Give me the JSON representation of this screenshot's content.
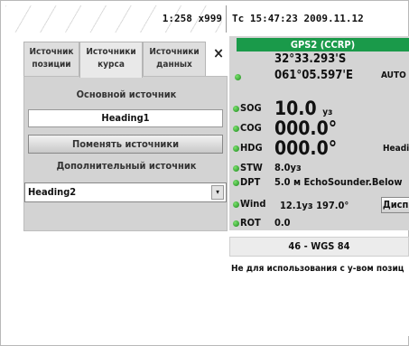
{
  "topbar": {
    "scale": "1:258 x999"
  },
  "clock": {
    "text": "Tc 15:47:23  2009.11.12"
  },
  "left_panel": {
    "tabs": [
      {
        "label": "Источник\nпозиции",
        "active": false
      },
      {
        "label": "Источники\nкурса",
        "active": true
      },
      {
        "label": "Источники\nданных",
        "active": false
      }
    ],
    "close_icon": "×",
    "primary_label": "Основной источник",
    "primary_value": "Heading1",
    "swap_button": "Поменять источники",
    "secondary_label": "Дополнительный источник",
    "secondary_value": "Heading2",
    "dropdown_icon": "▾"
  },
  "nav": {
    "header": "GPS2 (CCRP)",
    "lat": "32°33.293'S",
    "lon": "061°05.597'E",
    "mode": "AUTO",
    "sog": {
      "label": "SOG",
      "value": "10.0",
      "unit": "уз"
    },
    "cog": {
      "label": "COG",
      "value": "000.0°"
    },
    "hdg": {
      "label": "HDG",
      "value": "000.0°",
      "extra": "Headir"
    },
    "stw": {
      "label": "STW",
      "value": "8.0уз"
    },
    "dpt": {
      "label": "DPT",
      "value": "5.0 м  EchoSounder.Below"
    },
    "wind": {
      "label": "Wind",
      "value": "12.1уз  197.0°"
    },
    "rot": {
      "label": "ROT",
      "value": "0.0"
    },
    "disp_button": "Дисп.",
    "status_color": "#1c8a1c",
    "header_color": "#1a9a4a"
  },
  "datum": {
    "title": "46 - WGS 84",
    "note": "Не для использования с у-вом позиц"
  }
}
